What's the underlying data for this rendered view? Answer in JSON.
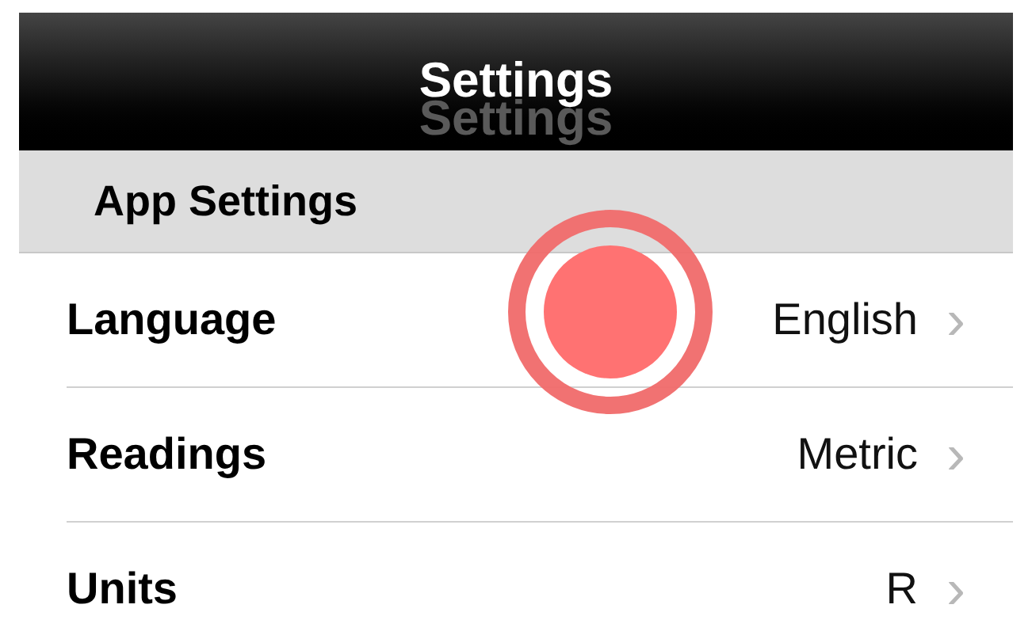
{
  "nav_bar": {
    "title": "Settings",
    "ghost_title": "Settings"
  },
  "section": {
    "header": "App Settings",
    "rows": [
      {
        "label": "Language",
        "value": "English",
        "chevron": "›"
      },
      {
        "label": "Readings",
        "value": "Metric",
        "chevron": "›"
      },
      {
        "label": "Units",
        "value": "R",
        "chevron": "›"
      }
    ]
  }
}
